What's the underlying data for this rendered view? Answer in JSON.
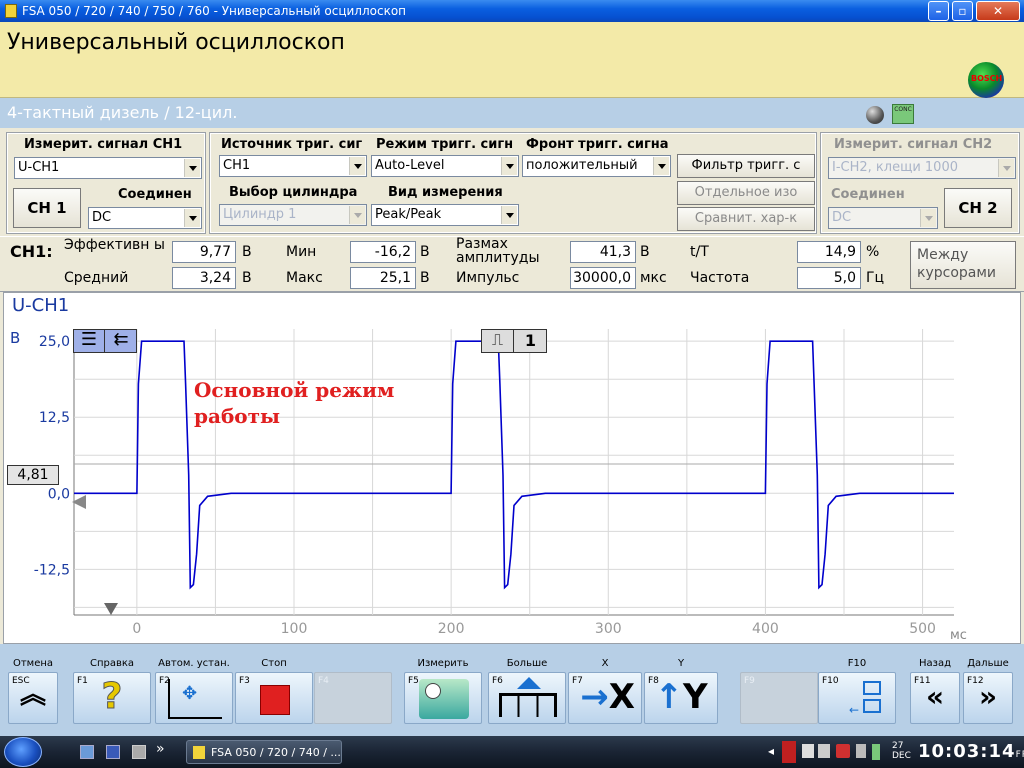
{
  "window": {
    "title": "FSA 050 / 720 / 740 / 750 / 760 - Универсальный осциллоскоп"
  },
  "header": {
    "title": "Универсальный осциллоскоп",
    "logo_text": "BOSCH"
  },
  "subheader": {
    "text": "4-тактный дизель / 12-цил.",
    "icon_text": "CONC"
  },
  "ch1": {
    "label": "Измерит. сигнал CH1",
    "signal": "U-CH1",
    "button": "CH 1",
    "coupling_label": "Соединен",
    "coupling": "DC"
  },
  "trigger": {
    "source_label": "Источник триг. сиг",
    "source": "CH1",
    "mode_label": "Режим тригг. сигн",
    "mode": "Auto-Level",
    "edge_label": "Фронт тригг. сигна",
    "edge": "положительный",
    "filter_button": "Фильтр тригг. с",
    "cyl_label": "Выбор цилиндра",
    "cyl": "Цилиндр 1",
    "meas_label": "Вид измерения",
    "meas": "Peak/Peak",
    "separate_button": "Отдельное изо",
    "compare_button": "Сравнит. хар-к"
  },
  "ch2": {
    "label": "Измерит. сигнал CH2",
    "signal": "I-CH2, клещи 1000",
    "coupling_label": "Соединен",
    "coupling": "DC",
    "button": "CH 2"
  },
  "measurements": {
    "channel": "CH1:",
    "rms_label": "Эффективн ый",
    "rms": "9,77",
    "rms_unit": "В",
    "avg_label": "Средний",
    "avg": "3,24",
    "avg_unit": "В",
    "min_label": "Мин",
    "min": "-16,2",
    "min_unit": "В",
    "max_label": "Макс",
    "max": "25,1",
    "max_unit": "В",
    "amp_label": "Размах амплитуды",
    "amp": "41,3",
    "amp_unit": "В",
    "pulse_label": "Импульс",
    "pulse": "30000,0",
    "pulse_unit": "мкс",
    "tt_label": "t/T",
    "tt": "14,9",
    "tt_unit": "%",
    "freq_label": "Частота",
    "freq": "5,0",
    "freq_unit": "Гц",
    "cursor_button": "Между курсорами"
  },
  "scope": {
    "channel_title": "U-CH1",
    "annotation": "Основной режим работы",
    "trigger_level": "4,81",
    "trigger_number": "1"
  },
  "chart_data": {
    "type": "line",
    "ylabel": "В",
    "xlabel": "мс",
    "xlim": [
      -40,
      520
    ],
    "ylim": [
      -20,
      27
    ],
    "y_ticks": [
      "25,0",
      "12,5",
      "0,0",
      "-12,5"
    ],
    "y_tick_values": [
      25,
      12.5,
      0,
      -12.5
    ],
    "x_ticks": [
      "0",
      "100",
      "200",
      "300",
      "400",
      "500"
    ],
    "x_tick_values": [
      0,
      100,
      200,
      300,
      400,
      500
    ],
    "grid": true,
    "color": "#0000cc",
    "series": [
      {
        "x": [
          -40,
          0,
          1,
          3,
          30,
          31,
          33,
          34,
          36,
          38,
          40,
          45,
          60,
          100,
          200,
          201,
          203,
          230,
          231,
          233,
          234,
          236,
          238,
          240,
          245,
          260,
          300,
          400,
          401,
          403,
          430,
          431,
          433,
          434,
          436,
          438,
          440,
          445,
          460,
          520
        ],
        "y": [
          0,
          0,
          18,
          25,
          25,
          18,
          3,
          -15.5,
          -15,
          -10,
          -2,
          -0.5,
          0,
          0,
          0,
          18,
          25,
          25,
          18,
          3,
          -15.5,
          -15,
          -10,
          -2,
          -0.5,
          0,
          0,
          0,
          18,
          25,
          25,
          18,
          3,
          -15.5,
          -15,
          -10,
          -2,
          -0.5,
          0,
          0
        ]
      }
    ]
  },
  "fkeys": [
    {
      "caption": "Отмена",
      "num": "ESC",
      "icon": "double-chevron-up-icon",
      "disabled": false
    },
    {
      "caption": "Справка",
      "num": "F1",
      "icon": "question-icon",
      "disabled": false
    },
    {
      "caption": "Автом. устан.",
      "num": "F2",
      "icon": "auto-setup-icon",
      "disabled": false
    },
    {
      "caption": "Стоп",
      "num": "F3",
      "icon": "stop-icon",
      "disabled": false
    },
    {
      "caption": "",
      "num": "F4",
      "icon": "",
      "disabled": true
    },
    {
      "caption": "Измерить",
      "num": "F5",
      "icon": "measure-icon",
      "disabled": false
    },
    {
      "caption": "Больше",
      "num": "F6",
      "icon": "more-icon",
      "disabled": false
    },
    {
      "caption": "X",
      "num": "F7",
      "icon": "x-axis-icon",
      "disabled": false
    },
    {
      "caption": "Y",
      "num": "F8",
      "icon": "y-axis-icon",
      "disabled": false
    },
    {
      "caption": "",
      "num": "F9",
      "icon": "",
      "disabled": true
    },
    {
      "caption": "F10",
      "num": "F10",
      "icon": "f10-icon",
      "disabled": false
    },
    {
      "caption": "Назад",
      "num": "F11",
      "icon": "double-chevron-left-icon",
      "disabled": false
    },
    {
      "caption": "Дальше",
      "num": "F12",
      "icon": "double-chevron-right-icon",
      "disabled": false
    }
  ],
  "taskbar": {
    "task": "FSA 050 / 720 / 740 / ...",
    "date_day": "27",
    "date_month": "DEC",
    "time": "10:03:",
    "time_sec": "14",
    "weekday": "FRI"
  }
}
